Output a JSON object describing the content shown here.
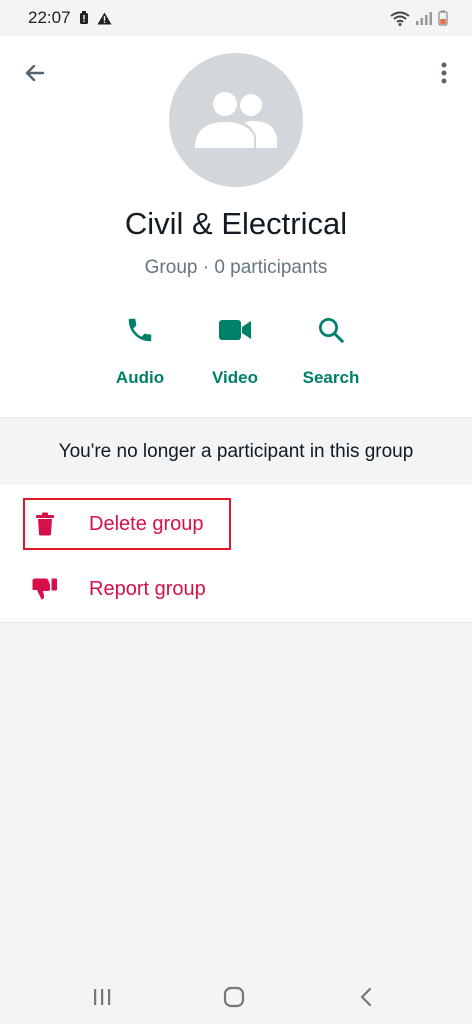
{
  "status_bar": {
    "time": "22:07",
    "icons": [
      "battery-saver-icon",
      "warning-icon",
      "wifi-icon",
      "signal-icon",
      "battery-icon"
    ]
  },
  "header": {
    "back_icon": "arrow-left-icon",
    "more_icon": "more-vertical-icon"
  },
  "group": {
    "name": "Civil & Electrical",
    "subtitle": "Group · 0 participants",
    "avatar_icon": "group-avatar-icon"
  },
  "actions": [
    {
      "label": "Audio",
      "icon": "phone-icon"
    },
    {
      "label": "Video",
      "icon": "video-camera-icon"
    },
    {
      "label": "Search",
      "icon": "search-icon"
    }
  ],
  "notice": "You're no longer a participant in this group",
  "options": [
    {
      "label": "Delete group",
      "icon": "trash-icon",
      "highlighted": true
    },
    {
      "label": "Report group",
      "icon": "thumbs-down-icon",
      "highlighted": false
    }
  ],
  "colors": {
    "accent": "#008069",
    "danger": "#d5104a",
    "highlight": "#e0162b",
    "avatar_bg": "#d1d7db",
    "background": "#f3f4f6"
  },
  "nav_bar": {
    "icons": [
      "recent-apps-icon",
      "home-icon",
      "back-nav-icon"
    ]
  }
}
